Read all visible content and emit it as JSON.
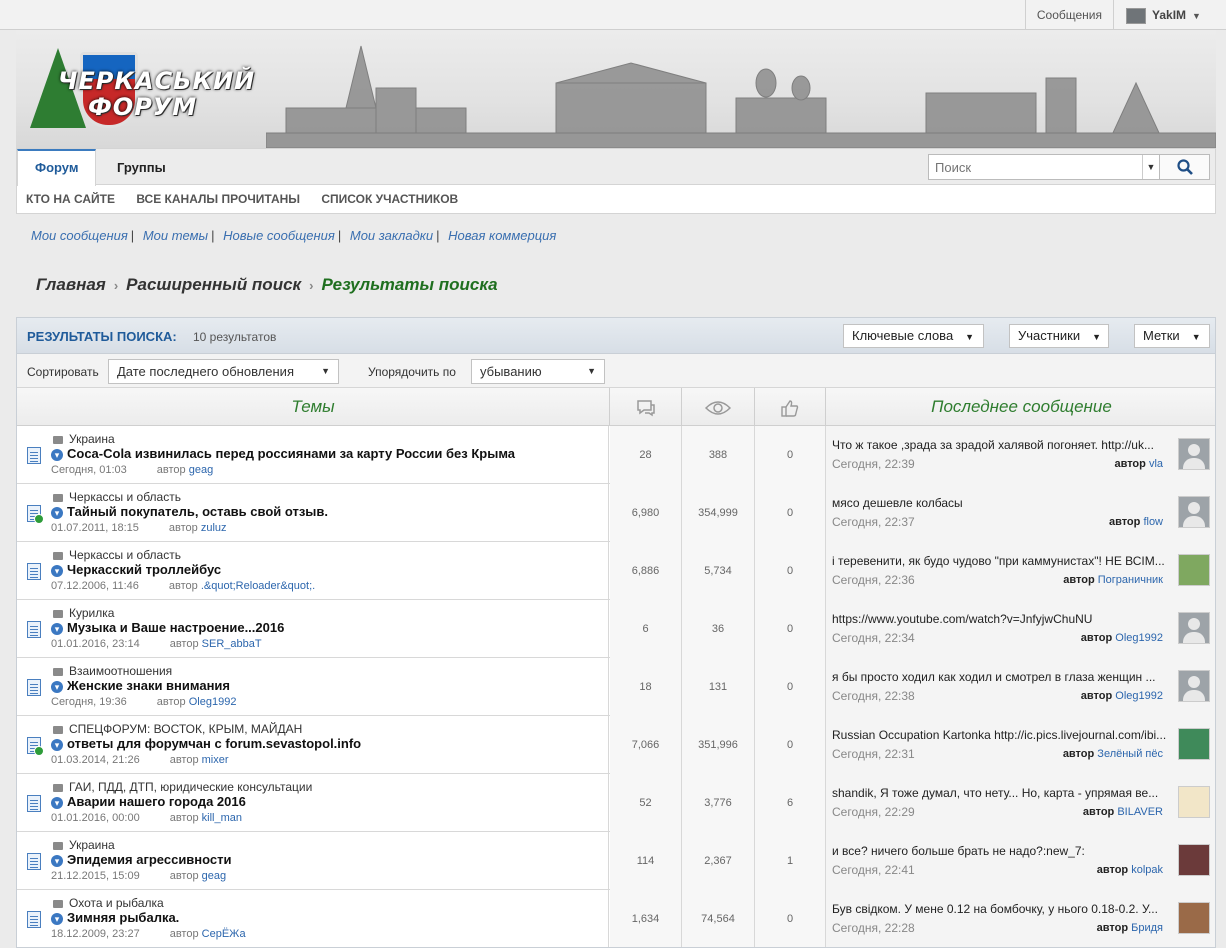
{
  "topbar": {
    "messages": "Сообщения",
    "username": "YakIM"
  },
  "logo": {
    "line1": "ЧЕРКАСЬКИЙ",
    "line2": "ФОРУМ"
  },
  "nav": {
    "tabs": [
      "Форум",
      "Группы"
    ],
    "subnav": [
      "Кто на сайте",
      "Все каналы прочитаны",
      "Список участников"
    ],
    "search_placeholder": "Поиск"
  },
  "quick_links": [
    "Мои сообщения",
    "Мои темы",
    "Новые сообщения",
    "Мои закладки",
    "Новая коммерция"
  ],
  "breadcrumb": [
    "Главная",
    "Расширенный поиск",
    "Результаты поиска"
  ],
  "results": {
    "title": "Результаты поиска:",
    "count": "10 результатов",
    "filters": [
      "Ключевые слова",
      "Участники",
      "Метки"
    ],
    "sort_label": "Сортировать",
    "sort_value": "Дате последнего обновления",
    "order_label": "Упорядочить по",
    "order_value": "убыванию",
    "columns": {
      "topics": "Темы",
      "replies_icon": "comments-icon",
      "views_icon": "eye-icon",
      "likes_icon": "thumbs-up-icon",
      "last": "Последнее сообщение"
    }
  },
  "rows": [
    {
      "forum": "Украина",
      "title": "Coca-Cola извинилась перед россиянами за карту России без Крыма",
      "date": "Сегодня, 01:03",
      "author": "geag",
      "replies": "28",
      "views": "388",
      "likes": "0",
      "last_text": "Что ж такое ,зрада за зрадой халявой погоняет. http://uk...",
      "last_date": "Сегодня, 22:39",
      "last_author": "vla",
      "avatar": "default",
      "hot": false
    },
    {
      "forum": "Черкассы и область",
      "title": "Тайный покупатель, оставь свой отзыв.",
      "date": "01.07.2011, 18:15",
      "author": "zuluz",
      "replies": "6,980",
      "views": "354,999",
      "likes": "0",
      "last_text": "мясо дешевле колбасы",
      "last_date": "Сегодня, 22:37",
      "last_author": "flow",
      "avatar": "default",
      "hot": true
    },
    {
      "forum": "Черкассы и область",
      "title": "Черкасский троллейбус",
      "date": "07.12.2006, 11:46",
      "author": ".&quot;Reloader&quot;.",
      "replies": "6,886",
      "views": "5,734",
      "likes": "0",
      "last_text": "і теревенити, як будо чудово \"при каммунистах\"! НЕ ВСІМ...",
      "last_date": "Сегодня, 22:36",
      "last_author": "Пограничник",
      "avatar": "#7fa860",
      "hot": false
    },
    {
      "forum": "Курилка",
      "title": "Музыка и Ваше настроение...2016",
      "date": "01.01.2016, 23:14",
      "author": "SER_abbaT",
      "replies": "6",
      "views": "36",
      "likes": "0",
      "last_text": "https://www.youtube.com/watch?v=JnfyjwChuNU",
      "last_date": "Сегодня, 22:34",
      "last_author": "Oleg1992",
      "avatar": "default",
      "hot": false
    },
    {
      "forum": "Взаимоотношения",
      "title": "Женские знаки внимания",
      "date": "Сегодня, 19:36",
      "author": "Oleg1992",
      "replies": "18",
      "views": "131",
      "likes": "0",
      "last_text": "я бы просто ходил как ходил и смотрел в глаза женщин ...",
      "last_date": "Сегодня, 22:38",
      "last_author": "Oleg1992",
      "avatar": "default",
      "hot": false
    },
    {
      "forum": "СПЕЦФОРУМ: ВОСТОК, КРЫМ, МАЙДАН",
      "title": "ответы для форумчан с forum.sevastopol.info",
      "date": "01.03.2014, 21:26",
      "author": "mixer",
      "replies": "7,066",
      "views": "351,996",
      "likes": "0",
      "last_text": "Russian Occupation Kartonka http://ic.pics.livejournal.com/ibi...",
      "last_date": "Сегодня, 22:31",
      "last_author": "Зелёный пёс",
      "avatar": "#3f8a5a",
      "hot": true
    },
    {
      "forum": "ГАИ, ПДД, ДТП, юридические консультации",
      "title": "Аварии нашего города 2016",
      "date": "01.01.2016, 00:00",
      "author": "kill_man",
      "replies": "52",
      "views": "3,776",
      "likes": "6",
      "last_text": "shandik, Я тоже думал, что нету... Но, карта - упрямая ве...",
      "last_date": "Сегодня, 22:29",
      "last_author": "BILAVER",
      "avatar": "#f2e6c8",
      "hot": false
    },
    {
      "forum": "Украина",
      "title": "Эпидемия агрессивности",
      "date": "21.12.2015, 15:09",
      "author": "geag",
      "replies": "114",
      "views": "2,367",
      "likes": "1",
      "last_text": "и все? ничего больше брать не надо?:new_7:",
      "last_date": "Сегодня, 22:41",
      "last_author": "kolpak",
      "avatar": "#6b3a3a",
      "hot": false
    },
    {
      "forum": "Охота и рыбалка",
      "title": "Зимняя рыбалка.",
      "date": "18.12.2009, 23:27",
      "author": "СерЁЖа",
      "replies": "1,634",
      "views": "74,564",
      "likes": "0",
      "last_text": "Був свідком. У мене 0.12 на бомбочку, у нього 0.18-0.2. У...",
      "last_date": "Сегодня, 22:28",
      "last_author": "Бридя",
      "avatar": "#9a6a48",
      "hot": false
    }
  ],
  "labels": {
    "by": "автор"
  }
}
